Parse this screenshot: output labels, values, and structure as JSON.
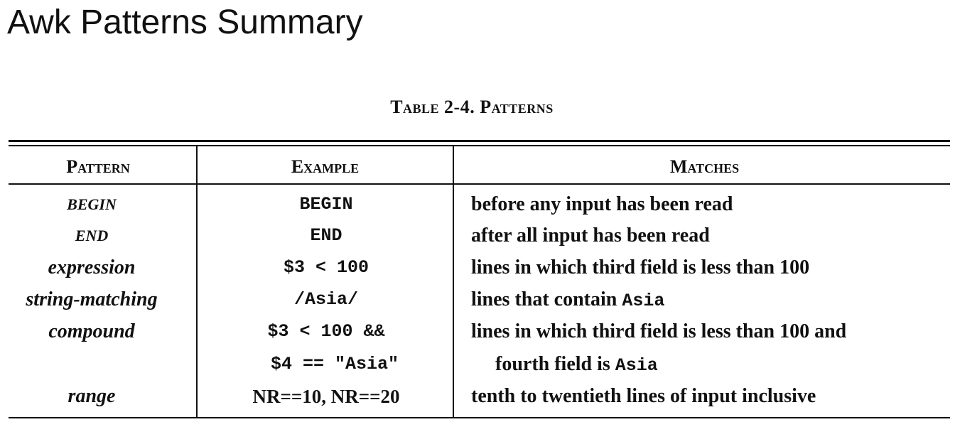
{
  "slide": {
    "title": "Awk Patterns Summary"
  },
  "table": {
    "caption": "Table 2-4. Patterns",
    "headers": {
      "pattern": "Pattern",
      "example": "Example",
      "matches": "Matches"
    },
    "rows": [
      {
        "pattern": "BEGIN",
        "example": "BEGIN",
        "matches": "before any input has been read"
      },
      {
        "pattern": "END",
        "example": "END",
        "matches": "after all input has been read"
      },
      {
        "pattern": "expression",
        "example": "$3 < 100",
        "matches": "lines in which third field is less than 100"
      },
      {
        "pattern": "string-matching",
        "example": "/Asia/",
        "matches_prefix": "lines that contain ",
        "matches_code": "Asia"
      },
      {
        "pattern": "compound",
        "example": "$3 < 100 &&",
        "matches": "lines in which third field is less than 100 and"
      },
      {
        "pattern": "",
        "example": "$4 == \"Asia\"",
        "matches_prefix": "fourth field is ",
        "matches_code": "Asia"
      },
      {
        "pattern": "range",
        "example": "NR==10, NR==20",
        "matches": "tenth to twentieth lines of input inclusive"
      }
    ]
  }
}
